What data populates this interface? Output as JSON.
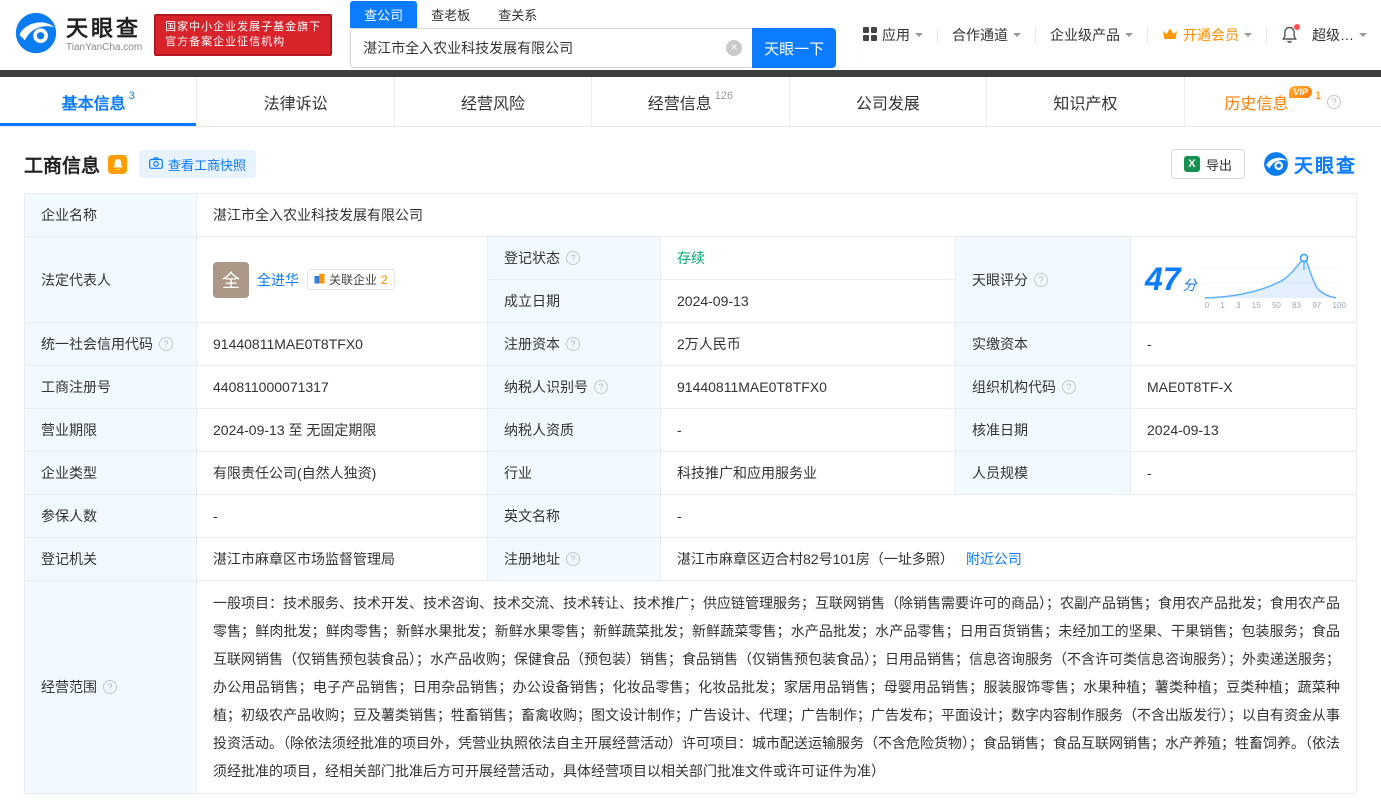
{
  "colors": {
    "brand_blue": "#0b7bff",
    "status_green": "#00a870",
    "vip_orange": "#ff8a00",
    "badge_red": "#d8232a",
    "history_orange": "#ff7e00"
  },
  "header": {
    "logo": {
      "title": "天眼查",
      "subtitle": "TianYanCha.com"
    },
    "badge": {
      "line1": "国家中小企业发展子基金旗下",
      "line2": "官方备案企业征信机构"
    },
    "search_tabs": [
      {
        "label": "查公司"
      },
      {
        "label": "查老板"
      },
      {
        "label": "查关系"
      }
    ],
    "search": {
      "value": "湛江市全入农业科技发展有限公司",
      "button": "天眼一下"
    },
    "nav": [
      {
        "label": "应用"
      },
      {
        "label": "合作通道"
      },
      {
        "label": "企业级产品"
      },
      {
        "label": "开通会员"
      },
      {
        "label": "超级…"
      }
    ]
  },
  "tabs": [
    {
      "label": "基本信息",
      "count": "3"
    },
    {
      "label": "法律诉讼"
    },
    {
      "label": "经营风险"
    },
    {
      "label": "经营信息",
      "count": "126"
    },
    {
      "label": "公司发展"
    },
    {
      "label": "知识产权"
    },
    {
      "label": "历史信息",
      "count": "1",
      "vip": "VIP"
    }
  ],
  "section": {
    "title": "工商信息",
    "snapshot_button": "查看工商快照",
    "export_button": "导出",
    "brand": "天眼查"
  },
  "company": {
    "name_label": "企业名称",
    "name": "湛江市全入农业科技发展有限公司",
    "legal_rep_label": "法定代表人",
    "legal_rep_avatar": "全",
    "legal_rep_name": "全进华",
    "related_tag": "关联企业",
    "related_count": "2",
    "reg_status_label": "登记状态",
    "reg_status": "存续",
    "est_date_label": "成立日期",
    "est_date": "2024-09-13",
    "score_label": "天眼评分",
    "score": "47",
    "score_unit": "分",
    "score_axis": [
      "0",
      "1",
      "3",
      "15",
      "50",
      "83",
      "97",
      "100"
    ],
    "credit_code_label": "统一社会信用代码",
    "credit_code": "91440811MAE0T8TFX0",
    "reg_capital_label": "注册资本",
    "reg_capital": "2万人民币",
    "paid_capital_label": "实缴资本",
    "paid_capital": "-",
    "reg_no_label": "工商注册号",
    "reg_no": "440811000071317",
    "taxpayer_id_label": "纳税人识别号",
    "taxpayer_id": "91440811MAE0T8TFX0",
    "org_code_label": "组织机构代码",
    "org_code": "MAE0T8TF-X",
    "term_label": "营业期限",
    "term": "2024-09-13 至 无固定期限",
    "taxpayer_quality_label": "纳税人资质",
    "taxpayer_quality": "-",
    "approval_date_label": "核准日期",
    "approval_date": "2024-09-13",
    "type_label": "企业类型",
    "type": "有限责任公司(自然人独资)",
    "industry_label": "行业",
    "industry": "科技推广和应用服务业",
    "staff_label": "人员规模",
    "staff": "-",
    "insured_label": "参保人数",
    "insured": "-",
    "english_name_label": "英文名称",
    "english_name": "-",
    "authority_label": "登记机关",
    "authority": "湛江市麻章区市场监督管理局",
    "address_label": "注册地址",
    "address": "湛江市麻章区迈合村82号101房（一址多照）",
    "address_link": "附近公司",
    "scope_label": "经营范围",
    "scope": "一般项目：技术服务、技术开发、技术咨询、技术交流、技术转让、技术推广；供应链管理服务；互联网销售（除销售需要许可的商品）；农副产品销售；食用农产品批发；食用农产品零售；鲜肉批发；鲜肉零售；新鲜水果批发；新鲜水果零售；新鲜蔬菜批发；新鲜蔬菜零售；水产品批发；水产品零售；日用百货销售；未经加工的坚果、干果销售；包装服务；食品互联网销售（仅销售预包装食品）；水产品收购；保健食品（预包装）销售；食品销售（仅销售预包装食品）；日用品销售；信息咨询服务（不含许可类信息咨询服务）；外卖递送服务；办公用品销售；电子产品销售；日用杂品销售；办公设备销售；化妆品零售；化妆品批发；家居用品销售；母婴用品销售；服装服饰零售；水果种植；薯类种植；豆类种植；蔬菜种植；初级农产品收购；豆及薯类销售；牲畜销售；畜禽收购；图文设计制作；广告设计、代理；广告制作；广告发布；平面设计；数字内容制作服务（不含出版发行）；以自有资金从事投资活动。（除依法须经批准的项目外，凭营业执照依法自主开展经营活动）许可项目：城市配送运输服务（不含危险货物）；食品销售；食品互联网销售；水产养殖；牲畜饲养。（依法须经批准的项目，经相关部门批准后方可开展经营活动，具体经营项目以相关部门批准文件或许可证件为准）"
  }
}
